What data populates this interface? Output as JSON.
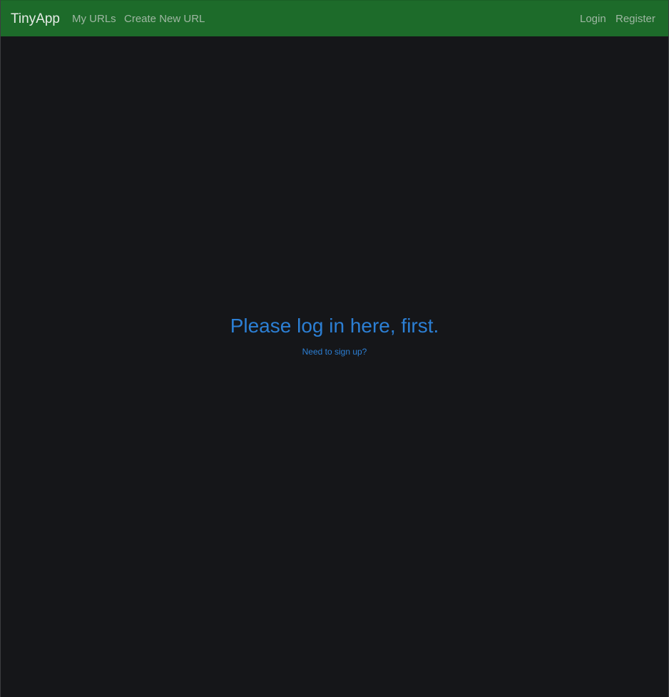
{
  "navbar": {
    "brand": "TinyApp",
    "links": {
      "my_urls": "My URLs",
      "create_new_url": "Create New URL",
      "login": "Login",
      "register": "Register"
    },
    "colors": {
      "background": "#1d6b2a",
      "brand_text": "#e6ece7",
      "link_text": "#9fb7a3"
    }
  },
  "main": {
    "heading": "Please log in here, first.",
    "signup_link": "Need to sign up?",
    "colors": {
      "background": "#151619",
      "accent": "#2c7fd4"
    }
  }
}
